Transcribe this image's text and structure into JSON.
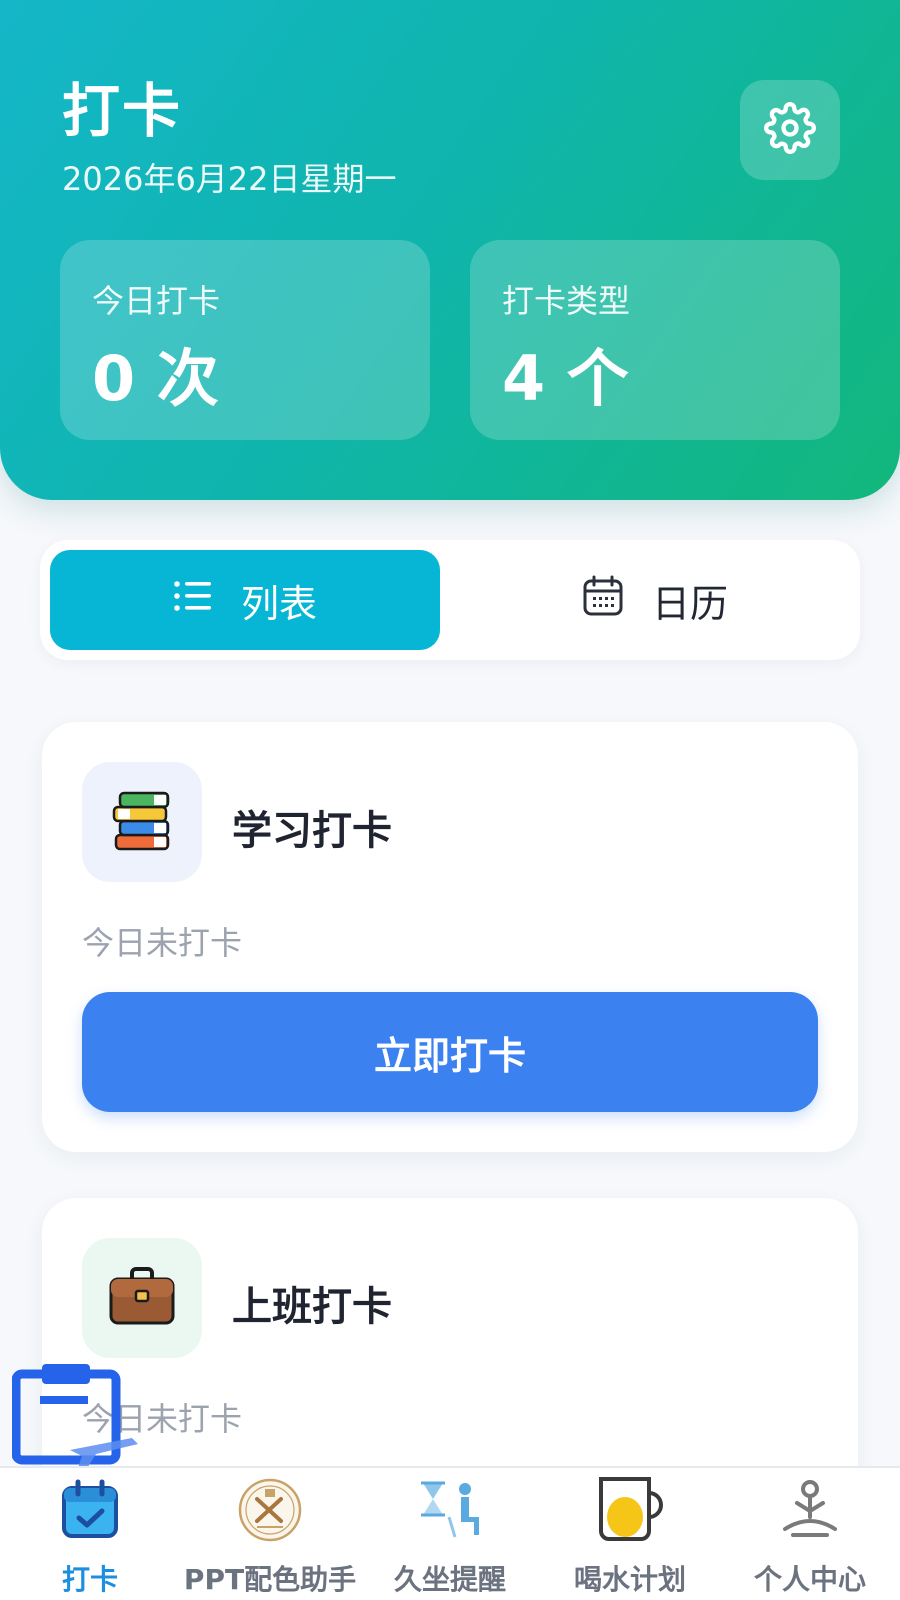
{
  "header": {
    "title": "打卡",
    "date": "2026年6月22日星期一",
    "settings_icon": "gear-icon",
    "stats": [
      {
        "label": "今日打卡",
        "value": "0 次"
      },
      {
        "label": "打卡类型",
        "value": "4 个"
      }
    ]
  },
  "view_toggle": {
    "list_label": "列表",
    "calendar_label": "日历",
    "active": "list"
  },
  "cards": [
    {
      "title": "学习打卡",
      "icon": "books-icon",
      "status": "今日未打卡",
      "button": "立即打卡"
    },
    {
      "title": "上班打卡",
      "icon": "briefcase-icon",
      "status": "今日未打卡"
    }
  ],
  "bottom_nav": [
    {
      "label": "打卡",
      "icon": "calendar-check-icon",
      "active": true
    },
    {
      "label": "PPT配色助手",
      "icon": "palette-badge-icon",
      "active": false
    },
    {
      "label": "久坐提醒",
      "icon": "hourglass-sitting-icon",
      "active": false
    },
    {
      "label": "喝水计划",
      "icon": "cup-icon",
      "active": false
    },
    {
      "label": "个人中心",
      "icon": "meditation-person-icon",
      "active": false
    }
  ],
  "colors": {
    "header_gradient_start": "#14b6c8",
    "header_gradient_end": "#12b77c",
    "toggle_active": "#06b6d4",
    "primary_button": "#3b82f0",
    "nav_active": "#1d8fe0"
  }
}
